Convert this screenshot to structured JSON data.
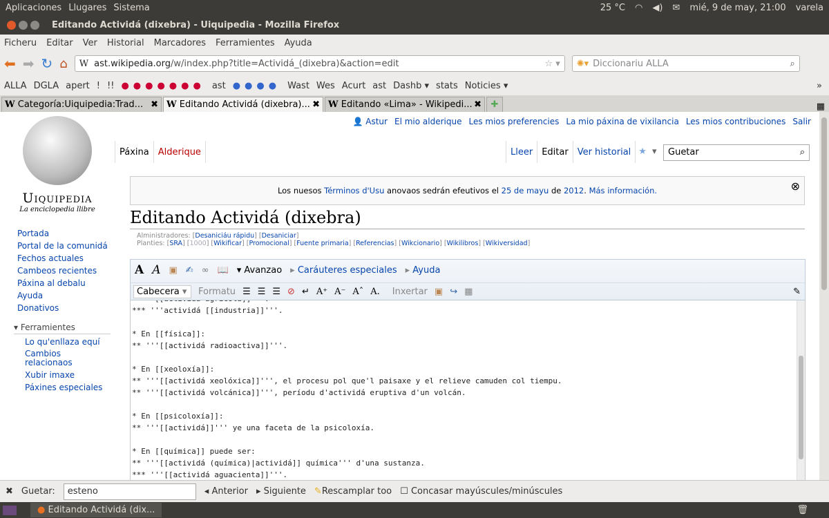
{
  "panel": {
    "menus": [
      "Aplicaciones",
      "Llugares",
      "Sistema"
    ],
    "temperature": "25 °C",
    "datetime": "mié, 9 de may, 21:00",
    "user": "varela"
  },
  "window": {
    "title": "Editando Actividá (dixebra) - Uiquipedia - Mozilla Firefox"
  },
  "menubar": [
    "Ficheru",
    "Editar",
    "Ver",
    "Historial",
    "Marcadores",
    "Ferramientes",
    "Ayuda"
  ],
  "nav": {
    "url_host": "ast.wikipedia.org",
    "url_path": "/w/index.php?title=Actividá_(dixebra)&action=edit",
    "search_placeholder": "Diccionariu ALLA"
  },
  "bookmarks": [
    "ALLA",
    "DGLA",
    "apert",
    "!",
    "!!",
    "ast",
    "Wast",
    "Wes",
    "Acurt",
    "ast",
    "Dashb ▾",
    "stats",
    "Noticies ▾"
  ],
  "tabs": [
    {
      "label": "Categoría:Uiquipedia:Trad...",
      "active": false
    },
    {
      "label": "Editando Actividá (dixebra)...",
      "active": true
    },
    {
      "label": "Editando «Lima» - Wikipedi...",
      "active": false
    }
  ],
  "wiki": {
    "logo_name": "Uiquipedia",
    "logo_tagline": "La enciclopedia llibre",
    "personal": [
      "Astur",
      "El mio alderique",
      "Les mios preferencies",
      "La mio páxina de vixilancia",
      "Les mios contribuciones",
      "Salir"
    ],
    "ns_tabs": [
      "Páxina",
      "Alderique"
    ],
    "view_tabs": [
      "Lleer",
      "Editar",
      "Ver historial"
    ],
    "search_placeholder": "Guetar",
    "sidebar": [
      "Portada",
      "Portal de la comunidá",
      "Fechos actuales",
      "Cambeos recientes",
      "Páxina al debalu",
      "Ayuda",
      "Donativos"
    ],
    "tools_heading": "Ferramientes",
    "tools": [
      "Lo qu'enllaza equí",
      "Cambios relacionaos",
      "Xubir imaxe",
      "Páxines especiales"
    ],
    "notice": {
      "pre": "Los nuesos ",
      "link1": "Términos d'Usu",
      "mid": " anovaos sedrán efeutivos el ",
      "date_link": "25 de mayu",
      "mid2": " de ",
      "year_link": "2012",
      "post": ". ",
      "more": "Más información."
    },
    "heading": "Editando Actividá (dixebra)",
    "admin_label": "Alministradores:",
    "admin_links": [
      "Desaniciáu rápidu",
      "Desaniciar"
    ],
    "templates_label": "Planties:",
    "template_links": [
      "SRA",
      "1000",
      "Wikificar",
      "Promocional",
      "Fuente primaria",
      "Referencias",
      "Wikcionario",
      "Wikilibros",
      "Wikiversidad"
    ],
    "toolbar": {
      "advanced": "Avanzao",
      "special": "Caráuteres especiales",
      "help": "Ayuda",
      "heading_select": "Cabecera",
      "format": "Formatu",
      "insert": "Inxertar"
    },
    "text_lines": [
      "***  [[actividá agrícola]]'''.",
      "*** '''actividá [[industria]]'''.",
      "",
      "* En [[física]]:",
      "** '''[[actividá radioactiva]]'''.",
      "",
      "* En [[xeoloxía]]:",
      "** '''[[actividá xeolóxica]]''', el procesu pol que'l paisaxe y el relieve camuden col tiempu.",
      "** '''[[actividá volcánica]]''', períodu d'actividá eruptiva d'un volcán.",
      "",
      "* En [[psicoloxía]]:",
      "** '''[[actividá]]''' ye una faceta de la psicoloxía.",
      "",
      "* En [[química]] puede ser:",
      "** '''[[actividá (química)|actividá]] química''' d'una sustanza.",
      "*** '''[[actividá aguacienta]]'''."
    ]
  },
  "findbar": {
    "label": "Guetar:",
    "value": "esteno",
    "prev": "Anterior",
    "next": "Siguiente",
    "highlight": "Rescamplar too",
    "match_case": "Concasar mayúscules/minúscules"
  },
  "taskbar": {
    "window": "Editando Actividá (dix..."
  }
}
